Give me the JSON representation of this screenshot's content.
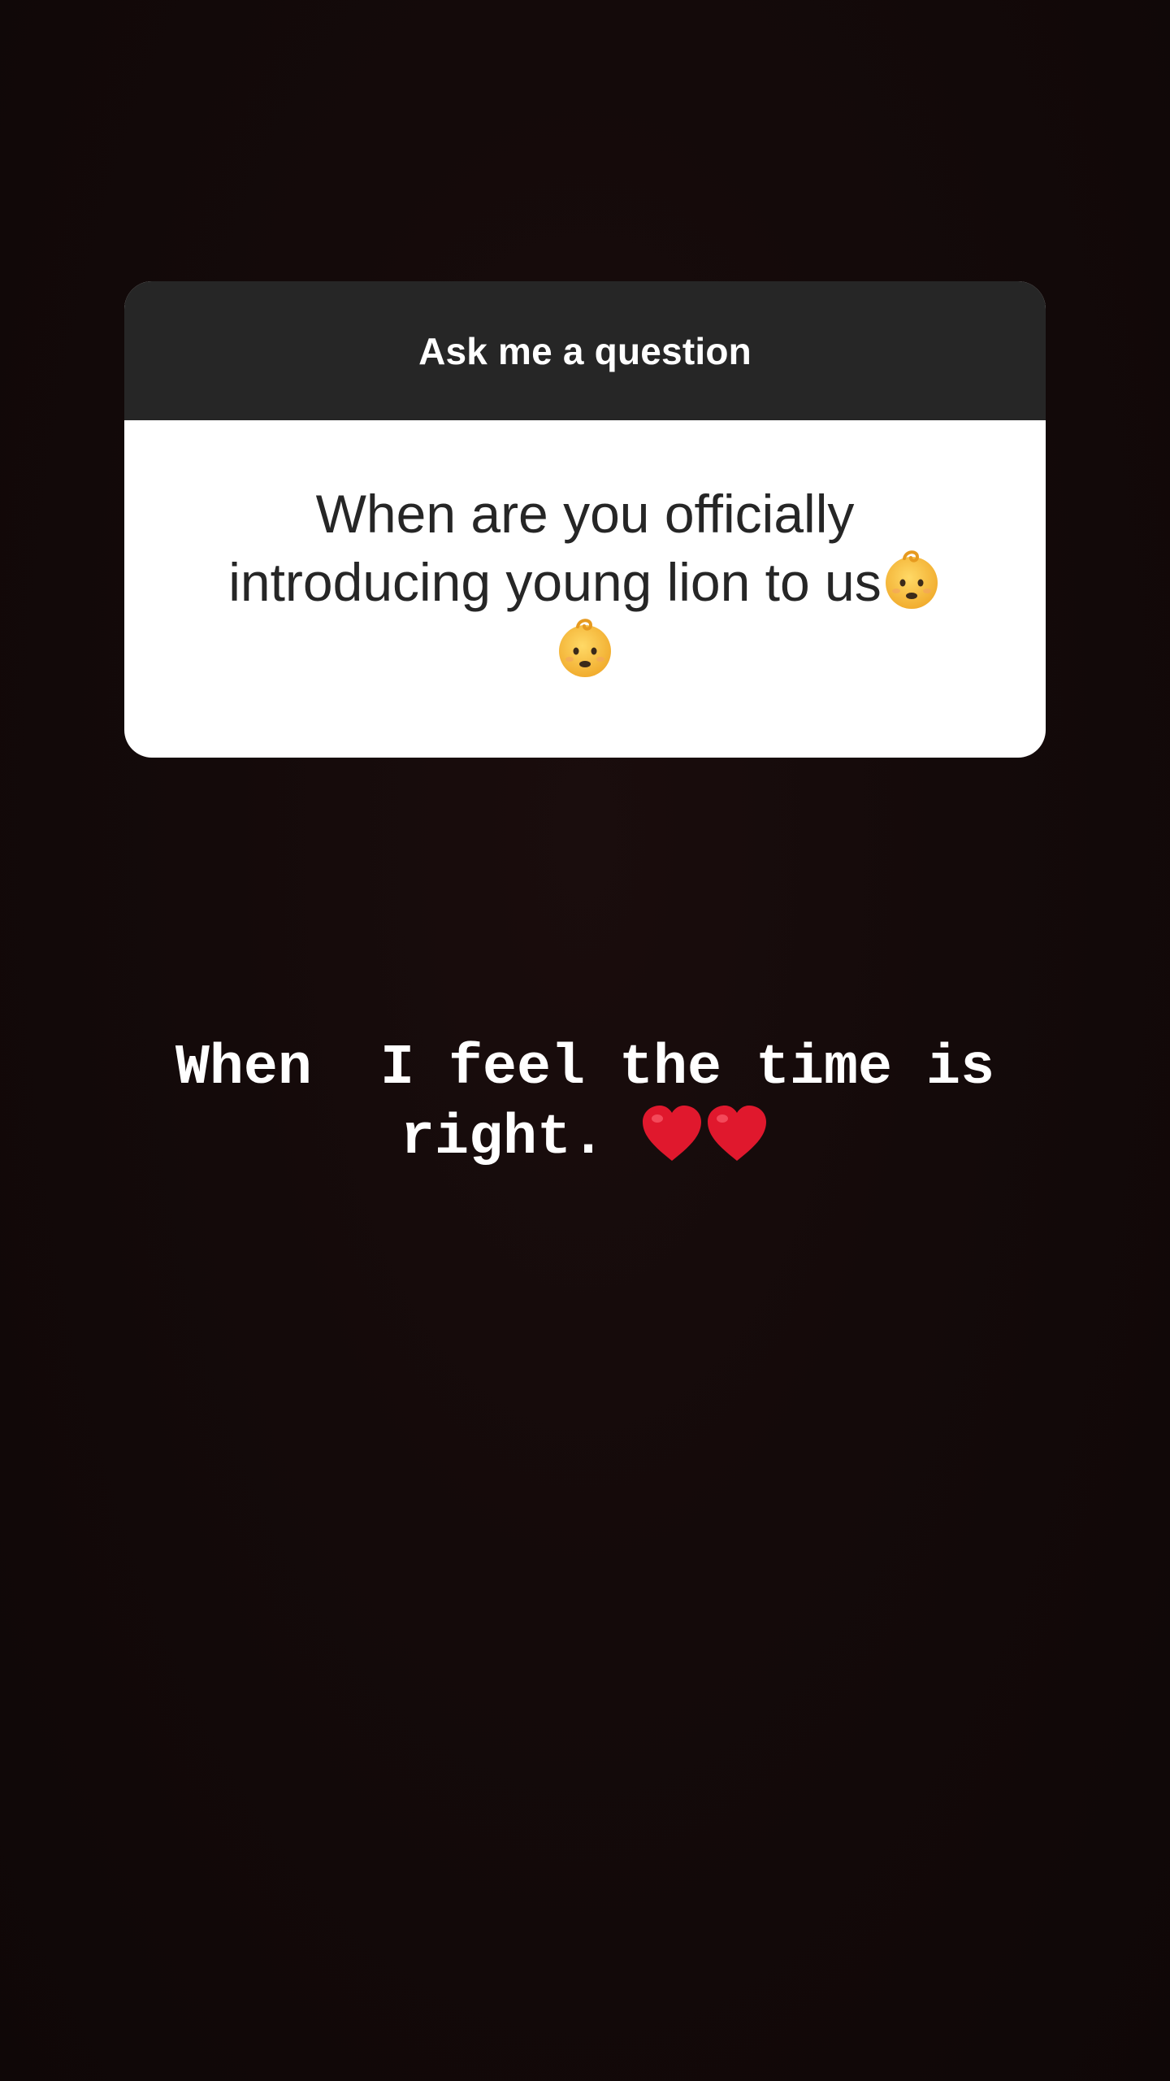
{
  "sticker": {
    "header_label": "Ask me a question",
    "question_text": "When are you officially introducing young lion to us",
    "question_emojis": [
      "baby-emoji",
      "baby-emoji"
    ]
  },
  "answer": {
    "line1": "When  I feel the time is",
    "line2": "right. ",
    "emojis": [
      "red-heart-emoji",
      "red-heart-emoji"
    ]
  },
  "colors": {
    "background": "#120909",
    "header_bg": "#262626",
    "card_bg": "#ffffff",
    "question_text": "#262626",
    "answer_text": "#ffffff",
    "heart": "#e0182d",
    "baby_skin": "#f8c03b"
  }
}
